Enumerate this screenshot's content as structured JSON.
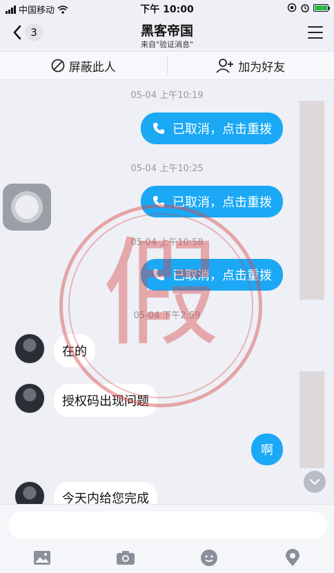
{
  "status_bar": {
    "carrier": "中国移动",
    "time": "下午 10:00"
  },
  "header": {
    "back_count": "3",
    "title": "黑客帝国",
    "subtitle": "来自\"验证消息\""
  },
  "actions": {
    "block_label": "屏蔽此人",
    "add_friend_label": "加为好友"
  },
  "chat": {
    "timestamps": [
      "05-04 上午10:19",
      "05-04 上午10:25",
      "05-04 上午10:58",
      "05-04 下午2:59"
    ],
    "call_status": "已取消，点击重拨",
    "incoming_messages": [
      "在的",
      "授权码出现问题",
      "今天内给您完成"
    ],
    "outgoing_text": "啊"
  },
  "stamp": {
    "text": "假"
  },
  "colors": {
    "bubble_blue": "#1ba8f5",
    "stamp_red": "#d64646",
    "background": "#eef0f5"
  }
}
